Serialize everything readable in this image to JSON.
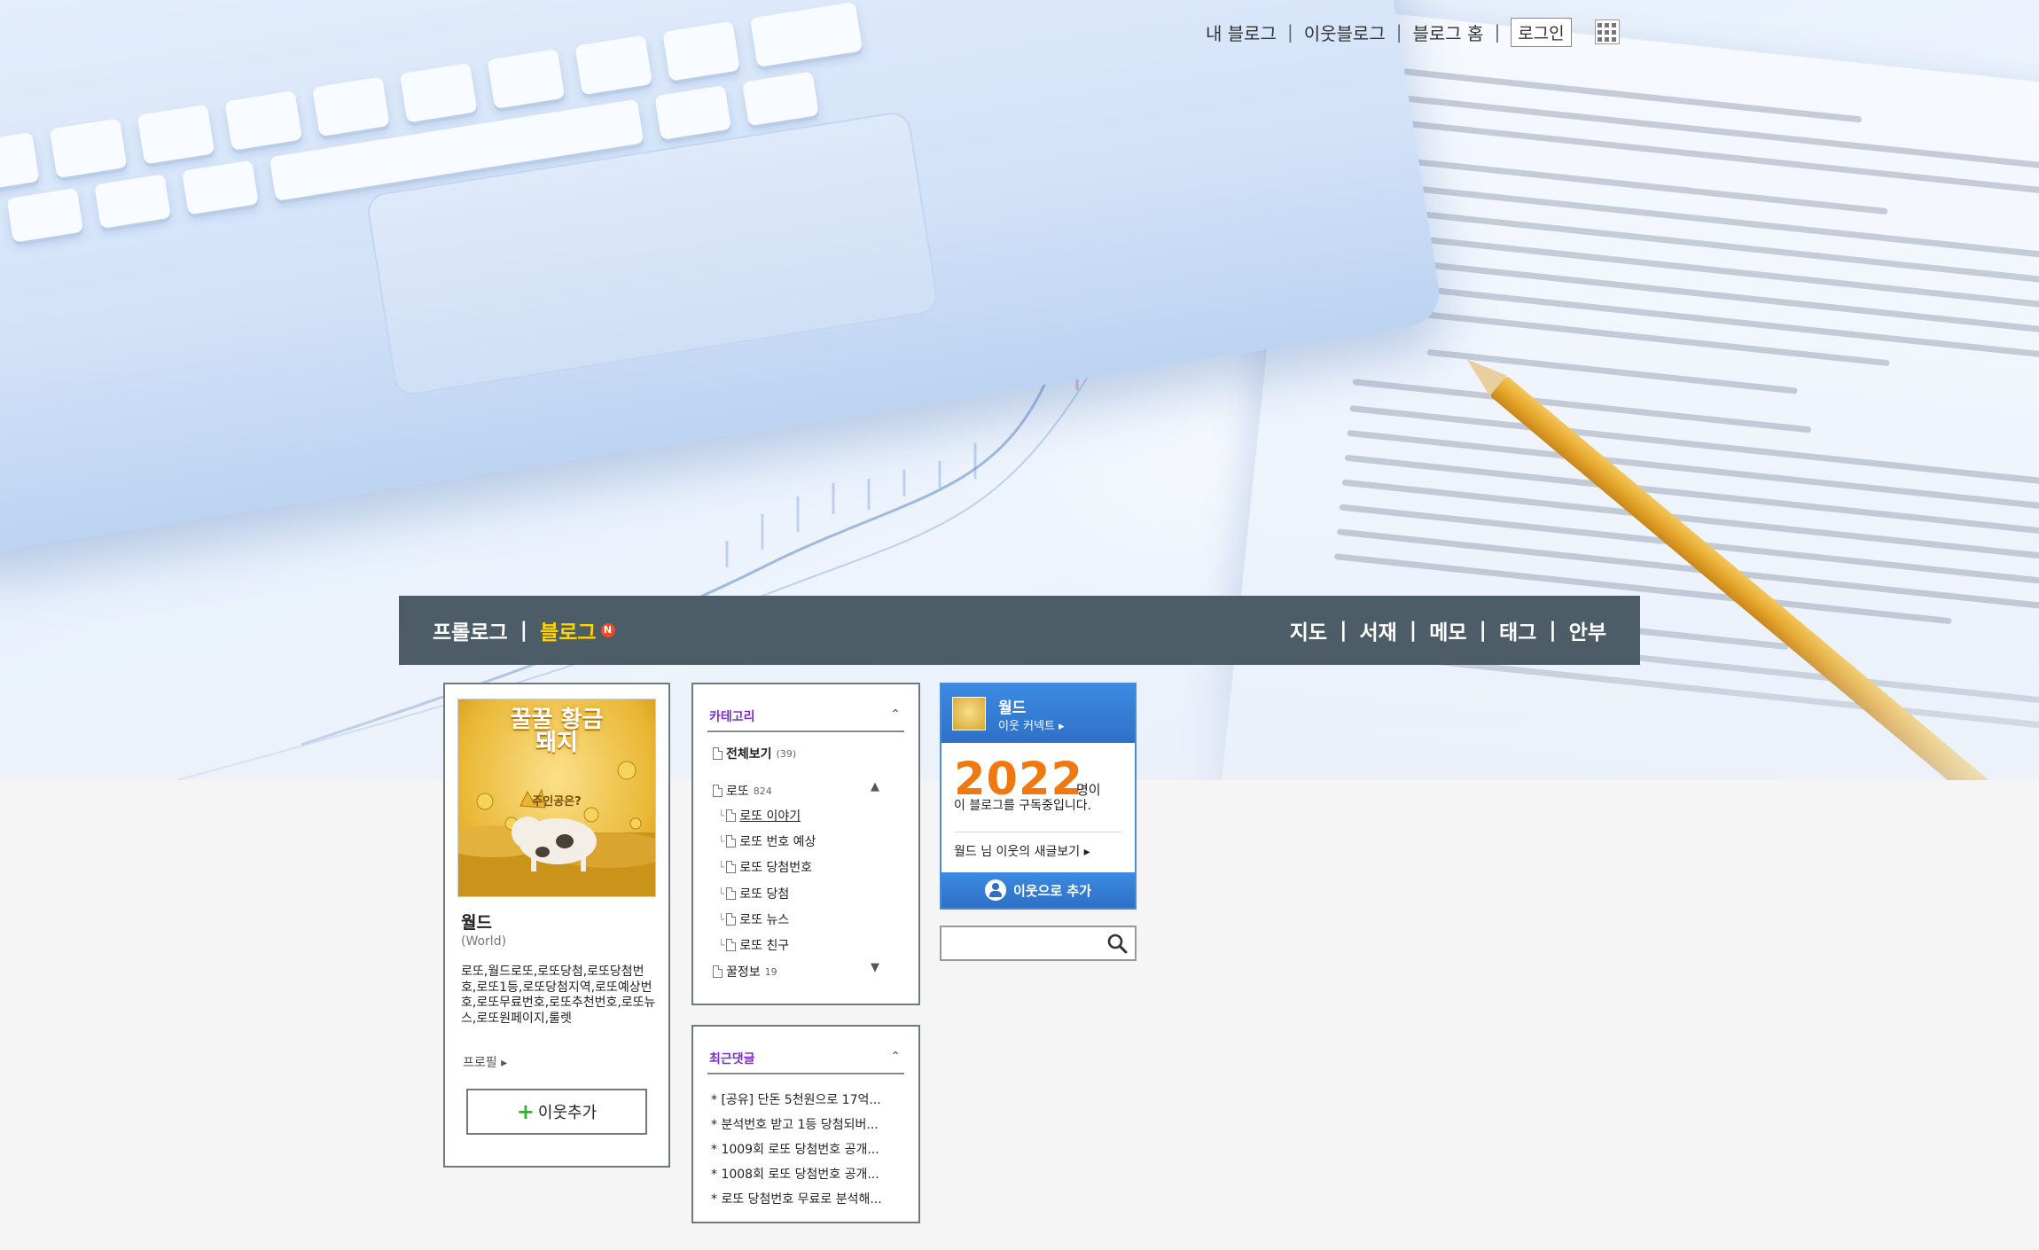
{
  "top_links": {
    "my_blog": "내 블로그",
    "neighbor_blog": "이웃블로그",
    "blog_home": "블로그 홈",
    "login": "로그인",
    "apps_icon": "grid-icon"
  },
  "nav": {
    "prologue": "프롤로그",
    "blog": "블로그",
    "new_badge": "N",
    "map": "지도",
    "library": "서재",
    "memo": "메모",
    "tag": "태그",
    "guestbook": "안부"
  },
  "profile": {
    "image_text": "꿀꿀 황금 돼지",
    "image_sub": "주인공은?",
    "name": "월드",
    "id": "(World)",
    "description": "로또,월드로또,로또당첨,로또당첨번호,로또1등,로또당첨지역,로또예상번호,로또무료번호,로또추천번호,로또뉴스,로또원페이지,룰렛",
    "profile_link": "프로필 ▸",
    "add_neighbor": "이웃추가"
  },
  "category": {
    "title": "카테고리",
    "items": [
      {
        "label": "전체보기",
        "count": "(39)"
      },
      {
        "label": "로또",
        "count": "824"
      },
      {
        "label": "로또 이야기",
        "count": ""
      },
      {
        "label": "로또 번호 예상",
        "count": ""
      },
      {
        "label": "로또 당첨번호",
        "count": ""
      },
      {
        "label": "로또 당첨",
        "count": ""
      },
      {
        "label": "로또 뉴스",
        "count": ""
      },
      {
        "label": "로또 친구",
        "count": ""
      },
      {
        "label": "꿀정보",
        "count": "19"
      }
    ]
  },
  "recent_comments": {
    "title": "최근댓글",
    "items": [
      "* [공유] 단돈 5천원으로 17억...",
      "* 분석번호 받고 1등 당첨되버...",
      "* 1009회 로또 당첨번호 공개...",
      "* 1008회 로또 당첨번호 공개...",
      "* 로또 당첨번호 무료로 분석해..."
    ]
  },
  "neighbor_widget": {
    "name": "월드",
    "connect": "이웃 커넥트 ▸",
    "count": "2022",
    "unit": "명이",
    "desc": "이 블로그를 구독중입니다.",
    "new_posts": "월드 님 이웃의 새글보기 ▸",
    "add_button": "이웃으로 추가"
  },
  "search": {
    "placeholder": ""
  },
  "colors": {
    "navbar": "#4c5d68",
    "nav_active": "#ffd400",
    "category_title": "#7b2fc9",
    "widget_blue": "#2f70c7",
    "count_orange": "#f07810",
    "plus_green": "#2bb52b"
  }
}
